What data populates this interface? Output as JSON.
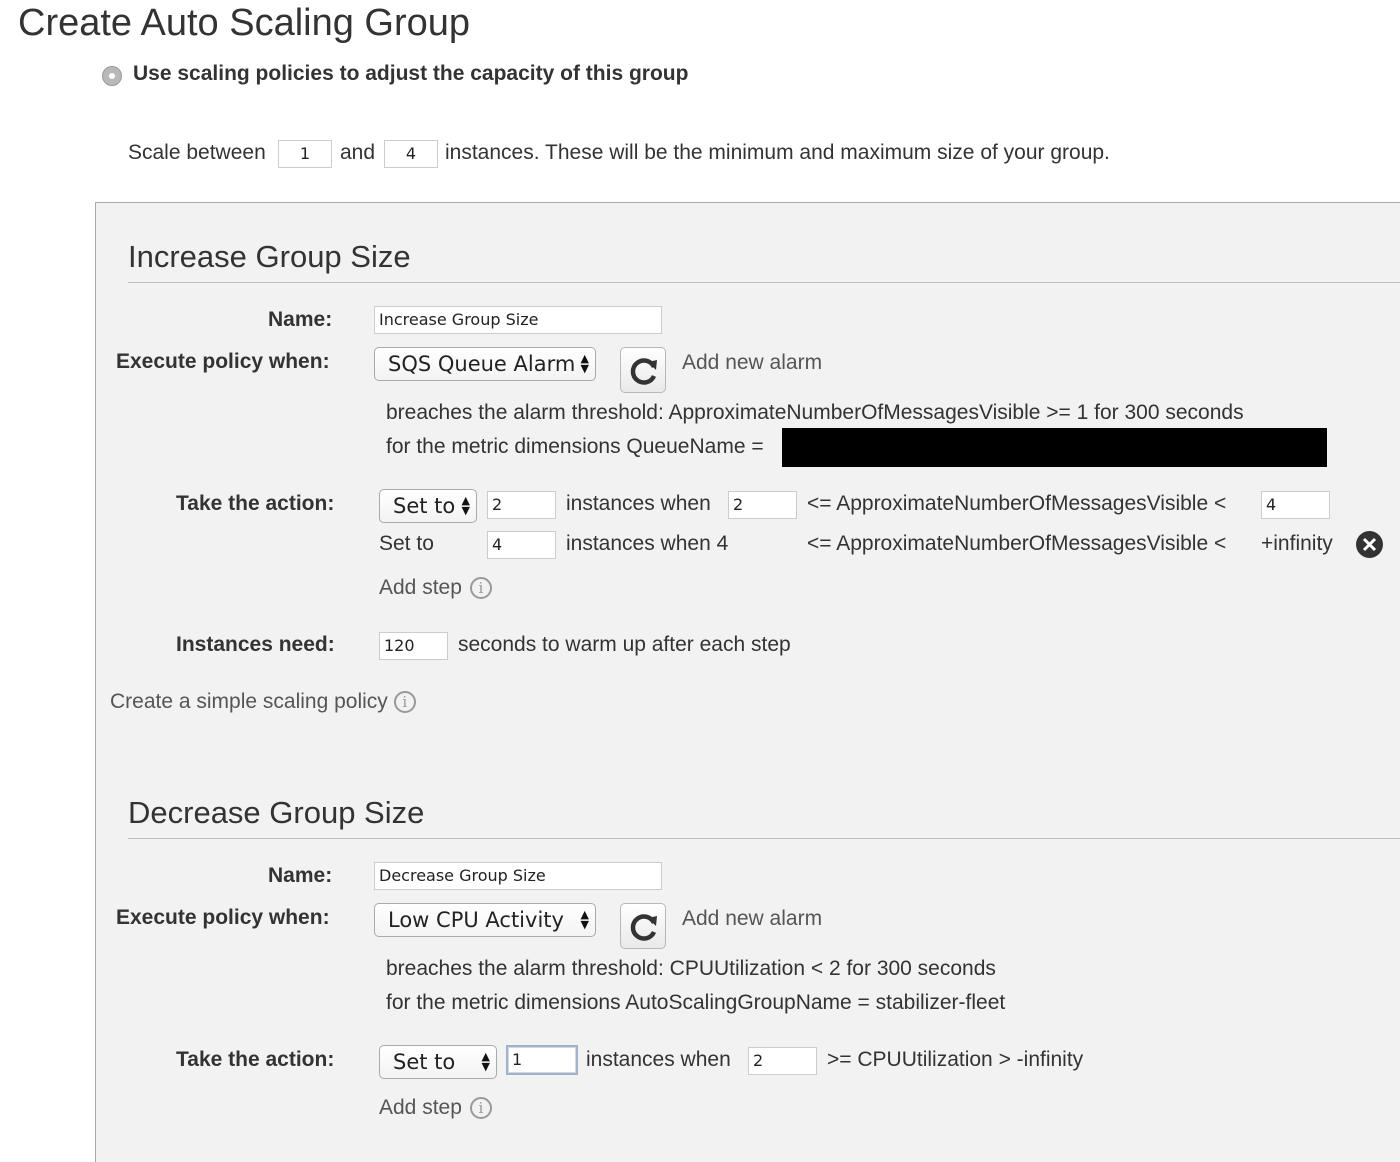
{
  "page_title": "Create Auto Scaling Group",
  "policy_option": {
    "label": "Use scaling policies to adjust the capacity of this group"
  },
  "scale_between": {
    "prefix": "Scale between",
    "min": "1",
    "and": "and",
    "max": "4",
    "suffix": "instances. These will be the minimum and maximum size of your group."
  },
  "labels": {
    "name": "Name:",
    "execute_policy": "Execute policy when:",
    "take_action": "Take the action:",
    "instances_need": "Instances need:"
  },
  "increase": {
    "title": "Increase Group Size",
    "name_value": "Increase Group Size",
    "alarm_select": "SQS Queue Alarm",
    "add_alarm": "Add new alarm",
    "breach_text": "breaches the alarm threshold: ApproximateNumberOfMessagesVisible >= 1 for 300 seconds",
    "dimensions_text": "for the metric dimensions QueueName =",
    "step1": {
      "action": "Set to",
      "instances": "2",
      "instances_when": "instances when",
      "lower": "2",
      "condition": "<= ApproximateNumberOfMessagesVisible <",
      "upper": "4"
    },
    "step2": {
      "action": "Set to",
      "instances": "4",
      "instances_when": "instances when 4",
      "condition": "<= ApproximateNumberOfMessagesVisible <",
      "upper": "+infinity"
    },
    "add_step": "Add step",
    "warmup_value": "120",
    "warmup_suffix": "seconds to warm up after each step",
    "simple_policy_link": "Create a simple scaling policy"
  },
  "decrease": {
    "title": "Decrease Group Size",
    "name_value": "Decrease Group Size",
    "alarm_select": "Low CPU Activity",
    "add_alarm": "Add new alarm",
    "breach_text": "breaches the alarm threshold: CPUUtilization < 2 for 300 seconds",
    "dimensions_text": "for the metric dimensions AutoScalingGroupName = stabilizer-fleet",
    "step1": {
      "action": "Set to",
      "instances": "1",
      "instances_when": "instances when",
      "lower": "2",
      "condition": ">= CPUUtilization > -infinity"
    },
    "add_step": "Add step"
  },
  "icons": {
    "refresh": "refresh-icon",
    "info": "info-icon",
    "remove": "close-circle-icon",
    "select_arrows": "up-down-arrows-icon"
  },
  "colors": {
    "panel_bg": "#f2f2f2",
    "text": "#333333",
    "link": "#555555",
    "redaction": "#000000"
  }
}
